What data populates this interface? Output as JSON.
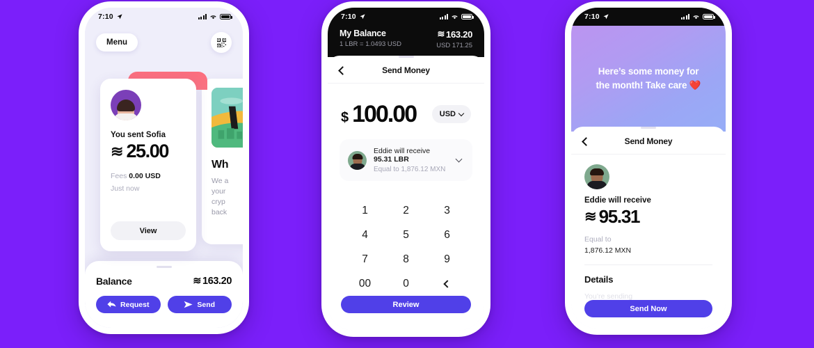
{
  "background_color": "#7B1FFA",
  "accent_color": "#5040E8",
  "status_bar": {
    "time": "7:10",
    "location_icon": "location-arrow-icon",
    "signal_icon": "signal-bars-icon",
    "wifi_icon": "wifi-icon",
    "battery_icon": "battery-icon"
  },
  "phone1": {
    "menu_button": "Menu",
    "qr_icon": "qr-code-icon",
    "transaction_card": {
      "avatar": "avatar-sofia",
      "title": "You sent Sofia",
      "currency_symbol": "≋",
      "amount": "25.00",
      "fees_label": "Fees",
      "fees_value": "0.00 USD",
      "timestamp": "Just now",
      "view_button": "View"
    },
    "side_card": {
      "illustration": "landscape-illustration",
      "heading": "Wh",
      "body": "We a\nyour\ncryp\nback"
    },
    "balance_sheet": {
      "label": "Balance",
      "currency_symbol": "≋",
      "amount": "163.20",
      "request_button": "Request",
      "request_icon": "arrow-left-icon",
      "send_button": "Send",
      "send_icon": "paper-plane-icon"
    }
  },
  "phone2": {
    "header": {
      "title": "My Balance",
      "rate": "1 LBR = 1.0493 USD",
      "currency_symbol": "≋",
      "balance": "163.20",
      "usd_equivalent": "USD 171.25"
    },
    "nav": {
      "back_icon": "chevron-left-icon",
      "title": "Send Money"
    },
    "amount_entry": {
      "symbol": "$",
      "value": "100.00",
      "currency": "USD",
      "currency_chevron": "chevron-down-icon"
    },
    "recipient_card": {
      "avatar": "avatar-eddie",
      "line1_prefix": "Eddie will receive ",
      "line1_amount": "95.31 LBR",
      "line2": "Equal to 1,876.12 MXN",
      "expand_icon": "chevron-down-icon"
    },
    "keypad": [
      "1",
      "2",
      "3",
      "4",
      "5",
      "6",
      "7",
      "8",
      "9",
      "00",
      "0",
      "backspace-icon"
    ],
    "review_button": "Review"
  },
  "phone3": {
    "hero_message": "Here’s some money for\nthe month! Take care ❤️",
    "nav": {
      "back_icon": "chevron-left-icon",
      "title": "Send Money"
    },
    "avatar": "avatar-eddie",
    "recipient_label": "Eddie will receive",
    "currency_symbol": "≋",
    "amount": "95.31",
    "equal_to_label": "Equal to",
    "equal_to_value": "1,876.12 MXN",
    "details_heading": "Details",
    "sending_label": "You’re sending",
    "send_now_button": "Send Now"
  }
}
